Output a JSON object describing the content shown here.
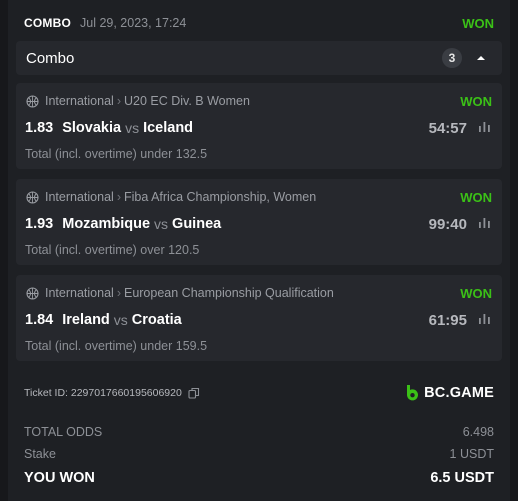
{
  "header": {
    "bet_type": "COMBO",
    "datetime": "Jul 29, 2023, 17:24",
    "status": "WON"
  },
  "combo": {
    "title": "Combo",
    "count": "3",
    "toggle_icon": "chevron-up-icon"
  },
  "legs": [
    {
      "category": "International",
      "league": "U20 EC Div. B Women",
      "status": "WON",
      "odds": "1.83",
      "home": "Slovakia",
      "vs": "vs",
      "away": "Iceland",
      "score": "54:57",
      "market": "Total (incl. overtime) under 132.5"
    },
    {
      "category": "International",
      "league": "Fiba Africa Championship, Women",
      "status": "WON",
      "odds": "1.93",
      "home": "Mozambique",
      "vs": "vs",
      "away": "Guinea",
      "score": "99:40",
      "market": "Total (incl. overtime) over 120.5"
    },
    {
      "category": "International",
      "league": "European Championship Qualification",
      "status": "WON",
      "odds": "1.84",
      "home": "Ireland",
      "vs": "vs",
      "away": "Croatia",
      "score": "61:95",
      "market": "Total (incl. overtime) under 159.5"
    }
  ],
  "ticket": {
    "label": "Ticket ID: 2297017660195606920",
    "brand": "BC.GAME"
  },
  "summary": {
    "total_odds_label": "TOTAL ODDS",
    "total_odds_value": "6.498",
    "stake_label": "Stake",
    "stake_value": "1 USDT",
    "won_label": "YOU WON",
    "won_value": "6.5 USDT"
  },
  "colors": {
    "background": "#1e2024",
    "panel": "#26282d",
    "win_green": "#3bc117",
    "muted_text": "#8d9096"
  }
}
